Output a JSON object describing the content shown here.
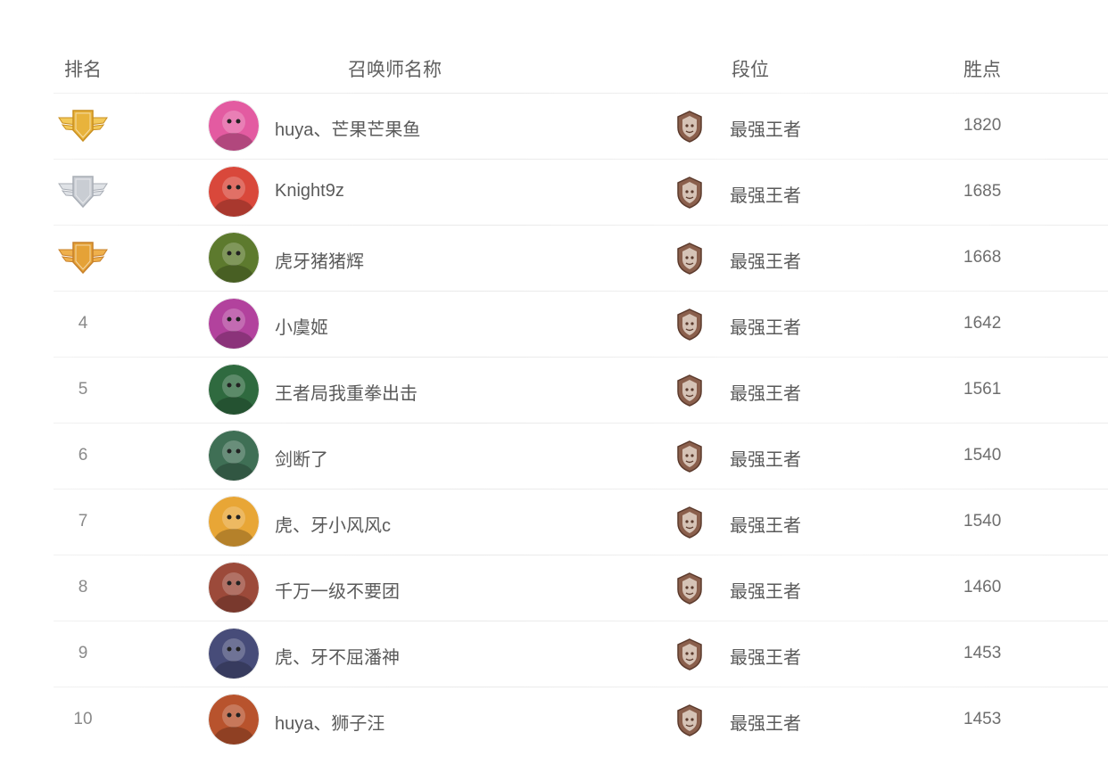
{
  "header": {
    "rank": "排名",
    "name": "召唤师名称",
    "tier": "段位",
    "points": "胜点"
  },
  "colors": {
    "gold": "#e8b33c",
    "silver": "#c9cdd3",
    "bronze": "#e5a237",
    "tier_icon": "#8a5f4c"
  },
  "rows": [
    {
      "rank": "1",
      "medal": "gold",
      "name": "huya、芒果芒果鱼",
      "tier": "最强王者",
      "points": "1820",
      "avatar_color": "#e35ba1"
    },
    {
      "rank": "2",
      "medal": "silver",
      "name": "Knight9z",
      "tier": "最强王者",
      "points": "1685",
      "avatar_color": "#d9483b"
    },
    {
      "rank": "3",
      "medal": "bronze",
      "name": "虎牙猪猪辉",
      "tier": "最强王者",
      "points": "1668",
      "avatar_color": "#5d7a2e"
    },
    {
      "rank": "4",
      "medal": "",
      "name": "小虞姬",
      "tier": "最强王者",
      "points": "1642",
      "avatar_color": "#b2429d"
    },
    {
      "rank": "5",
      "medal": "",
      "name": "王者局我重拳出击",
      "tier": "最强王者",
      "points": "1561",
      "avatar_color": "#2f6a3f"
    },
    {
      "rank": "6",
      "medal": "",
      "name": "剑断了",
      "tier": "最强王者",
      "points": "1540",
      "avatar_color": "#3f6f55"
    },
    {
      "rank": "7",
      "medal": "",
      "name": "虎、牙小风风c",
      "tier": "最强王者",
      "points": "1540",
      "avatar_color": "#e8a636"
    },
    {
      "rank": "8",
      "medal": "",
      "name": "千万一级不要团",
      "tier": "最强王者",
      "points": "1460",
      "avatar_color": "#9c4a3a"
    },
    {
      "rank": "9",
      "medal": "",
      "name": "虎、牙不屈潘神",
      "tier": "最强王者",
      "points": "1453",
      "avatar_color": "#474c79"
    },
    {
      "rank": "10",
      "medal": "",
      "name": "huya、狮子汪",
      "tier": "最强王者",
      "points": "1453",
      "avatar_color": "#b8532d"
    }
  ]
}
